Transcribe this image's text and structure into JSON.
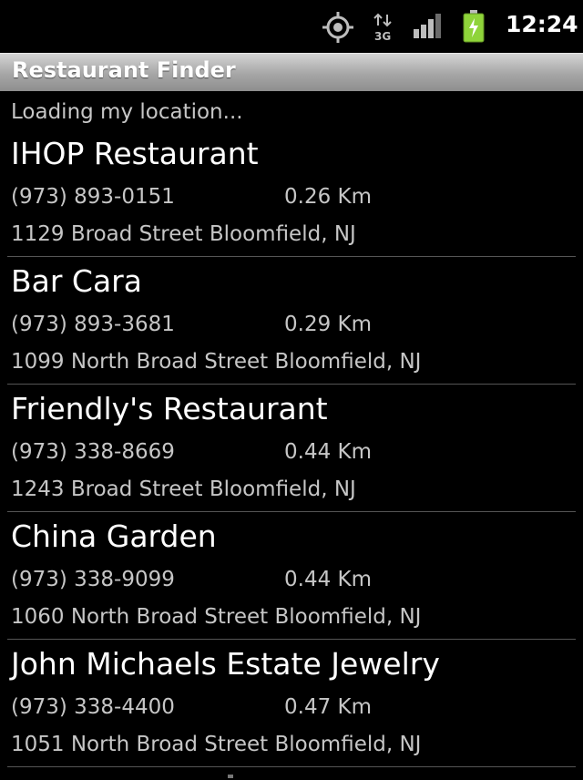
{
  "status_bar": {
    "time": "12:24",
    "network": "3G",
    "icons": [
      "gps-icon",
      "network-3g-icon",
      "signal-icon",
      "battery-icon"
    ]
  },
  "app": {
    "title": "Restaurant Finder"
  },
  "status_text": "Loading my location...",
  "restaurants": [
    {
      "name": "IHOP Restaurant",
      "phone": "(973) 893-0151",
      "distance": "0.26 Km",
      "address": "1129 Broad Street Bloomfield, NJ"
    },
    {
      "name": "Bar Cara",
      "phone": "(973) 893-3681",
      "distance": "0.29 Km",
      "address": "1099 North Broad Street Bloomfield, NJ"
    },
    {
      "name": "Friendly's Restaurant",
      "phone": "(973) 338-8669",
      "distance": "0.44 Km",
      "address": "1243 Broad Street Bloomfield, NJ"
    },
    {
      "name": "China Garden",
      "phone": "(973) 338-9099",
      "distance": "0.44 Km",
      "address": "1060 North Broad Street Bloomfield, NJ"
    },
    {
      "name": "John Michaels Estate Jewelry",
      "phone": "(973) 338-4400",
      "distance": "0.47 Km",
      "address": "1051 North Broad Street Bloomfield, NJ"
    }
  ],
  "colors": {
    "background": "#000000",
    "primary_text": "#ffffff",
    "secondary_text": "#c6c6c6",
    "title_bar": "#a6a6a6",
    "divider": "#555555",
    "battery": "#8fd43a"
  }
}
